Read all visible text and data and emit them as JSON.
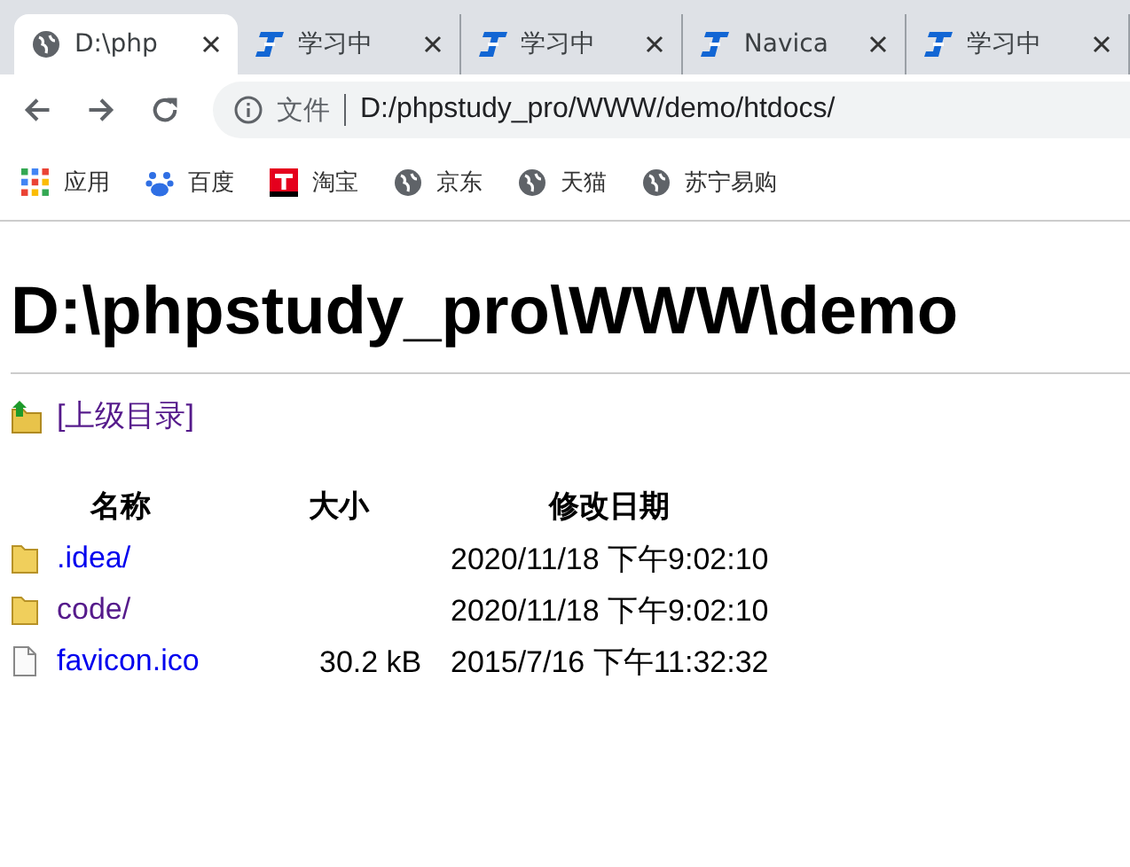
{
  "tabs": [
    {
      "title": "D:\\php",
      "selected": true
    },
    {
      "title": "学习中",
      "selected": false
    },
    {
      "title": "学习中",
      "selected": false
    },
    {
      "title": "Navica",
      "selected": false
    },
    {
      "title": "学习中",
      "selected": false
    }
  ],
  "address_bar": {
    "badge": "文件",
    "url": "D:/phpstudy_pro/WWW/demo/htdocs/"
  },
  "bookmarks": [
    {
      "label": "应用"
    },
    {
      "label": "百度"
    },
    {
      "label": "淘宝"
    },
    {
      "label": "京东"
    },
    {
      "label": "天猫"
    },
    {
      "label": "苏宁易购"
    }
  ],
  "page": {
    "heading": "D:\\phpstudy_pro\\WWW\\demo",
    "parent_link": {
      "label": "[上级目录]",
      "visited": true
    },
    "table": {
      "columns": [
        "名称",
        "大小",
        "修改日期"
      ],
      "rows": [
        {
          "kind": "folder",
          "name": ".idea/",
          "size": "",
          "modified": "2020/11/18 下午9:02:10",
          "visited": false
        },
        {
          "kind": "folder",
          "name": "code/",
          "size": "",
          "modified": "2020/11/18 下午9:02:10",
          "visited": true
        },
        {
          "kind": "file",
          "name": "favicon.ico",
          "size": "30.2 kB",
          "modified": "2015/7/16 下午11:32:32",
          "visited": false
        }
      ]
    }
  }
}
